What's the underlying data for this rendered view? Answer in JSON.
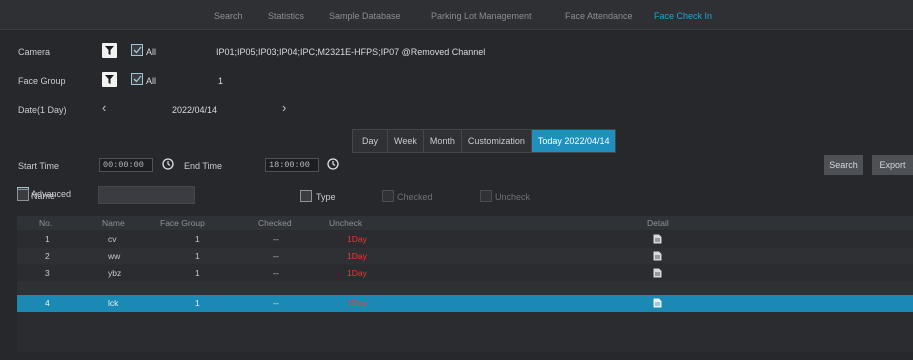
{
  "topnav": {
    "tabs": [
      {
        "label": "Search"
      },
      {
        "label": "Statistics"
      },
      {
        "label": "Sample Database"
      },
      {
        "label": "Parking Lot Management"
      },
      {
        "label": "Face Attendance"
      },
      {
        "label": "Face Check In"
      }
    ],
    "active_index": 5
  },
  "filters": {
    "camera_label": "Camera",
    "camera_all_label": "All",
    "camera_all_checked": true,
    "camera_list": "IP01;IP05;IP03;IP04;IPC;M2321E-HFPS;IP07  @Removed Channel",
    "face_group_label": "Face Group",
    "face_group_all_label": "All",
    "face_group_all_checked": true,
    "face_group_value": "1",
    "date_label": "Date(1 Day)",
    "date_value": "2022/04/14",
    "start_time_label": "Start Time",
    "start_time_value": "00:00:00",
    "end_time_label": "End Time",
    "end_time_value": "18:00:00",
    "advanced_label": "Advanced",
    "advanced_checked": true,
    "name_label": "Name",
    "name_value": "",
    "type_label": "Type",
    "checked_label": "Checked",
    "uncheck_label": "Uncheck"
  },
  "period_tabs": {
    "items": [
      "Day",
      "Week",
      "Month",
      "Customization",
      "Today 2022/04/14"
    ],
    "active_index": 4
  },
  "actions": {
    "search_label": "Search",
    "export_label": "Export"
  },
  "table": {
    "columns": [
      "No.",
      "Name",
      "Face Group",
      "Checked",
      "Uncheck",
      "Detail"
    ],
    "rows": [
      {
        "no": "1",
        "name": "cv",
        "group": "1",
        "checked": "--",
        "uncheck": "1Day"
      },
      {
        "no": "2",
        "name": "ww",
        "group": "1",
        "checked": "--",
        "uncheck": "1Day"
      },
      {
        "no": "3",
        "name": "ybz",
        "group": "1",
        "checked": "--",
        "uncheck": "1Day"
      },
      {
        "no": "4",
        "name": "lck",
        "group": "1",
        "checked": "--",
        "uncheck": "1Day"
      }
    ],
    "selected_index": 3
  },
  "colors": {
    "accent": "#1a89b4",
    "uncheck_text": "#ff2d2d",
    "background": "#26282c"
  }
}
